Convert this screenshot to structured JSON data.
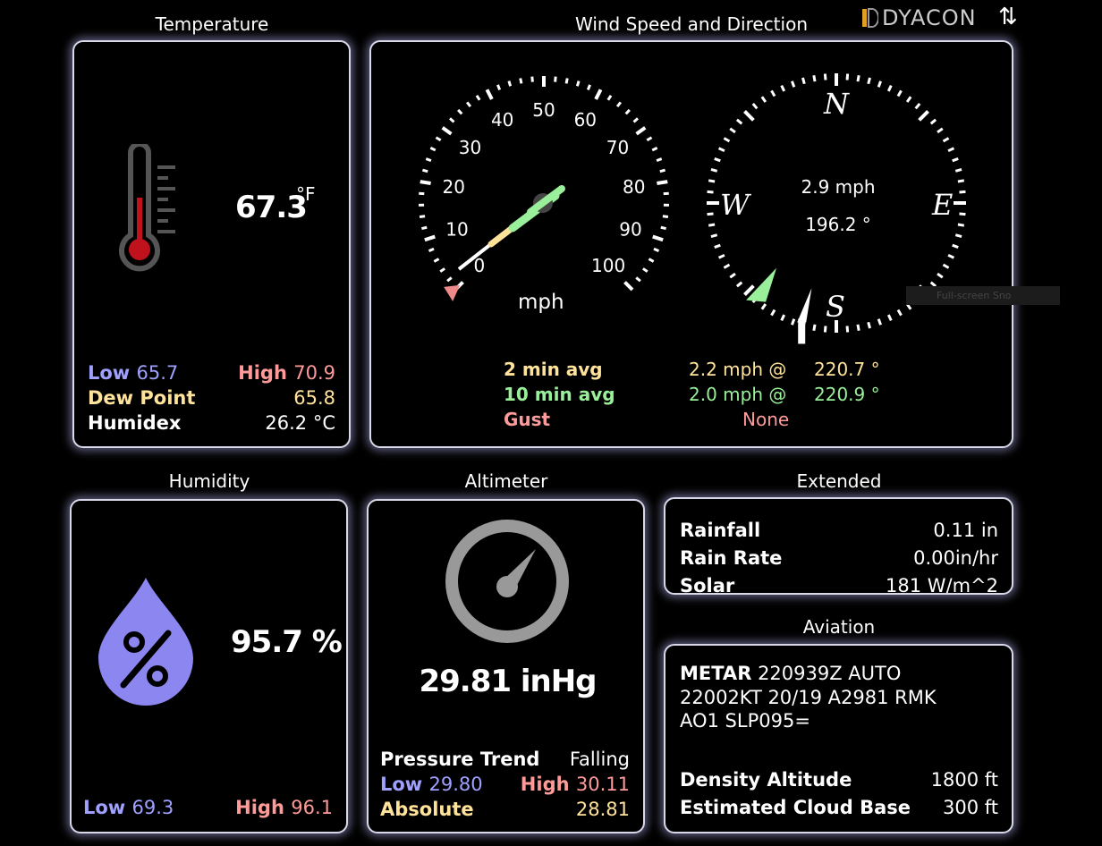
{
  "brand": {
    "name": "DYACON"
  },
  "temperature": {
    "title": "Temperature",
    "value": "67.3",
    "unit": "°F",
    "low_label": "Low",
    "low_value": "65.7",
    "high_label": "High",
    "high_value": "70.9",
    "dewpoint_label": "Dew Point",
    "dewpoint_value": "65.8",
    "humidex_label": "Humidex",
    "humidex_value": "26.2 °C"
  },
  "wind": {
    "title": "Wind Speed and Direction",
    "speed_dial": {
      "unit": "mph",
      "scale_min": 0,
      "scale_max": 100,
      "labels": [
        "0",
        "10",
        "20",
        "30",
        "40",
        "50",
        "60",
        "70",
        "80",
        "90",
        "100"
      ],
      "avg2_needle": 2.2,
      "avg10_needle": 2.0
    },
    "compass": {
      "N": "N",
      "E": "E",
      "S": "S",
      "W": "W",
      "speed": "2.9 mph",
      "direction": "196.2 °",
      "direction_deg": 196.2,
      "avg_direction_deg": 220.8
    },
    "avg2_label": "2 min avg",
    "avg2_speed": "2.2 mph @",
    "avg2_dir": "220.7 °",
    "avg10_label": "10 min avg",
    "avg10_speed": "2.0 mph @",
    "avg10_dir": "220.9 °",
    "gust_label": "Gust",
    "gust_value": "None"
  },
  "humidity": {
    "title": "Humidity",
    "value": "95.7 %",
    "low_label": "Low",
    "low_value": "69.3",
    "high_label": "High",
    "high_value": "96.1"
  },
  "altimeter": {
    "title": "Altimeter",
    "value": "29.81 inHg",
    "trend_label": "Pressure Trend",
    "trend_value": "Falling",
    "low_label": "Low",
    "low_value": "29.80",
    "high_label": "High",
    "high_value": "30.11",
    "absolute_label": "Absolute",
    "absolute_value": "28.81"
  },
  "extended": {
    "title": "Extended",
    "rows": [
      {
        "label": "Rainfall",
        "value": "0.11 in"
      },
      {
        "label": "Rain Rate",
        "value": "0.00in/hr"
      },
      {
        "label": "Solar",
        "value": "181 W/m^2"
      }
    ]
  },
  "aviation": {
    "title": "Aviation",
    "metar_label": "METAR",
    "metar_line1": "220939Z AUTO",
    "metar_line2": "22002KT 20/19 A2981 RMK",
    "metar_line3": "AO1 SLP095=",
    "density_label": "Density Altitude",
    "density_value": "1800 ft",
    "cloud_label": "Estimated Cloud Base",
    "cloud_value": "300 ft"
  },
  "tooltip": {
    "text": "Full-screen Sno"
  },
  "colors": {
    "low": "#a0a0ff",
    "high": "#ff9a9a",
    "dew": "#ffe39a",
    "avg10": "#9af09a",
    "panel_border": "#d8d8e8"
  }
}
